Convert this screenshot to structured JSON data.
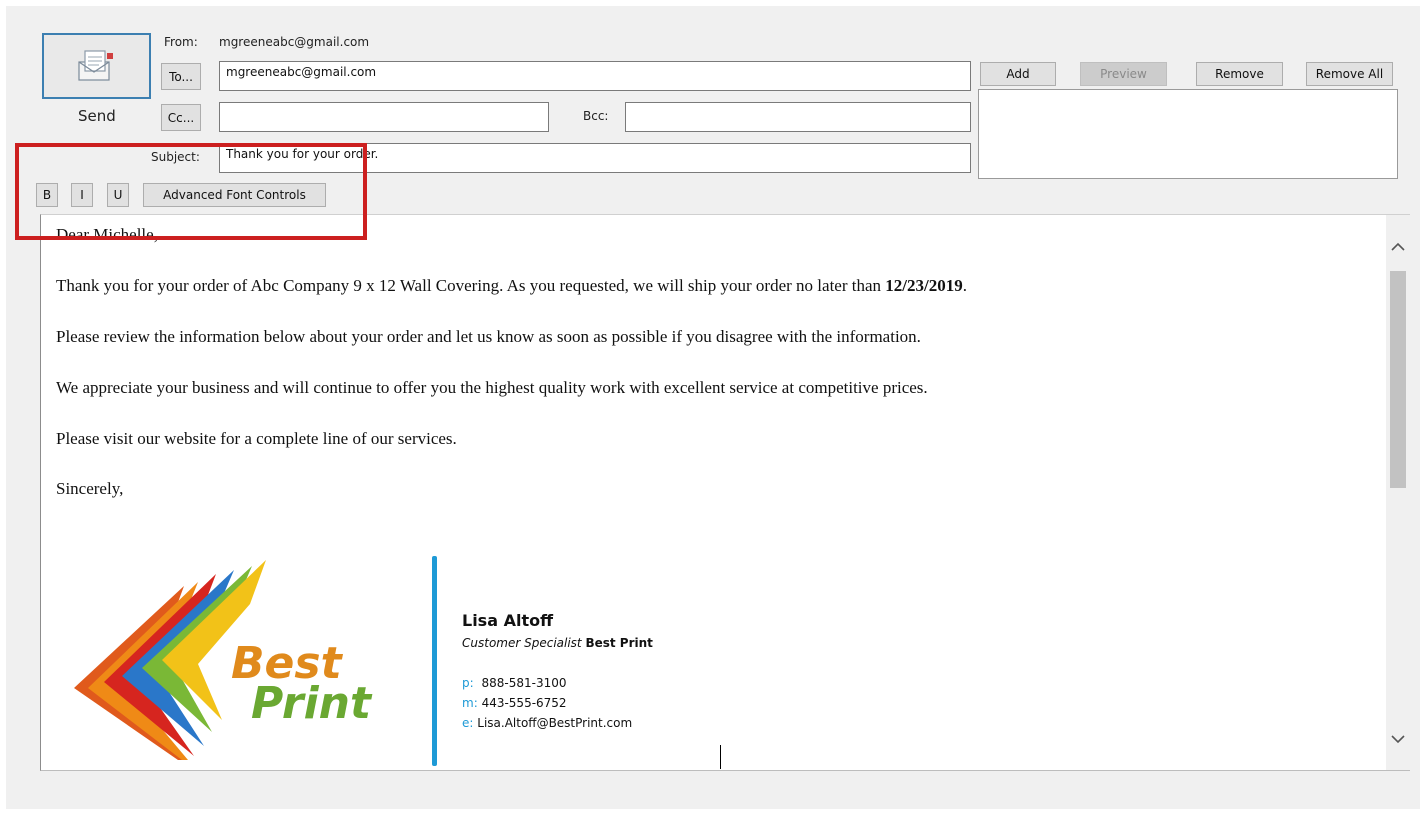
{
  "header": {
    "send_label": "Send",
    "from_label": "From:",
    "from_value": "mgreeneabc@gmail.com",
    "to_button": "To...",
    "to_value": "mgreeneabc@gmail.com",
    "cc_button": "Cc...",
    "cc_value": "",
    "bcc_label": "Bcc:",
    "bcc_value": "",
    "subject_label": "Subject:",
    "subject_value": "Thank you for your order."
  },
  "attachments": {
    "add": "Add",
    "preview": "Preview",
    "remove": "Remove",
    "remove_all": "Remove All"
  },
  "format_toolbar": {
    "bold": "B",
    "italic": "I",
    "underline": "U",
    "advanced": "Advanced Font Controls"
  },
  "body": {
    "greeting": "Dear Michelle,",
    "p1_start": "Thank you for your order of Abc Company 9 x 12 Wall Covering. As you requested, we will ship your order no later than ",
    "p1_date": "12/23/2019",
    "p1_end": ".",
    "p2": "Please review the information below about your order and let us know as soon as possible if you disagree with the information.",
    "p3": "We appreciate your business and will continue to offer you the highest quality work with excellent service at competitive prices.",
    "p4": "Please visit our website for a complete line of our services.",
    "closing": "Sincerely,"
  },
  "signature": {
    "logo_word1": "Best",
    "logo_word2": "Print",
    "name": "Lisa Altoff",
    "title": "Customer Specialist",
    "company": "Best Print",
    "phone_label": "p:",
    "phone": "888-581-3100",
    "mobile_label": "m:",
    "mobile": "443-555-6752",
    "email_label": "e:",
    "email": "Lisa.Altoff@BestPrint.com"
  },
  "colors": {
    "highlight_box": "#cc1f1f",
    "signature_accent": "#1e9ad6",
    "logo_text": "#6aa832"
  }
}
